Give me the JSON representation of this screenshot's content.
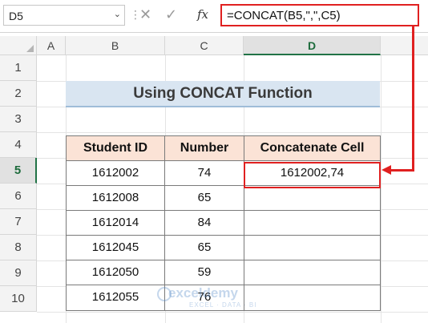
{
  "formula_bar": {
    "name_box": "D5",
    "name_box_arrow": "⌄",
    "separator": "⋮",
    "cancel_icon": "✕",
    "enter_icon": "✓",
    "fx_label": "fx",
    "formula": "=CONCAT(B5,\",\",C5)"
  },
  "columns": [
    "A",
    "B",
    "C",
    "D"
  ],
  "rows": [
    "1",
    "2",
    "3",
    "4",
    "5",
    "6",
    "7",
    "8",
    "9",
    "10"
  ],
  "title": "Using CONCAT Function",
  "table": {
    "headers": [
      "Student ID",
      "Number",
      "Concatenate Cell"
    ],
    "rows": [
      [
        "1612002",
        "74",
        "1612002,74"
      ],
      [
        "1612008",
        "65",
        ""
      ],
      [
        "1612014",
        "84",
        ""
      ],
      [
        "1612045",
        "65",
        ""
      ],
      [
        "1612050",
        "59",
        ""
      ],
      [
        "1612055",
        "76",
        ""
      ]
    ]
  },
  "watermark": {
    "name": "exceldemy",
    "tagline": "EXCEL · DATA · BI"
  },
  "colors": {
    "highlight": "#e02020",
    "header_fill": "#fbe3d6",
    "title_fill": "#d9e5f1",
    "active_header": "#217346"
  }
}
